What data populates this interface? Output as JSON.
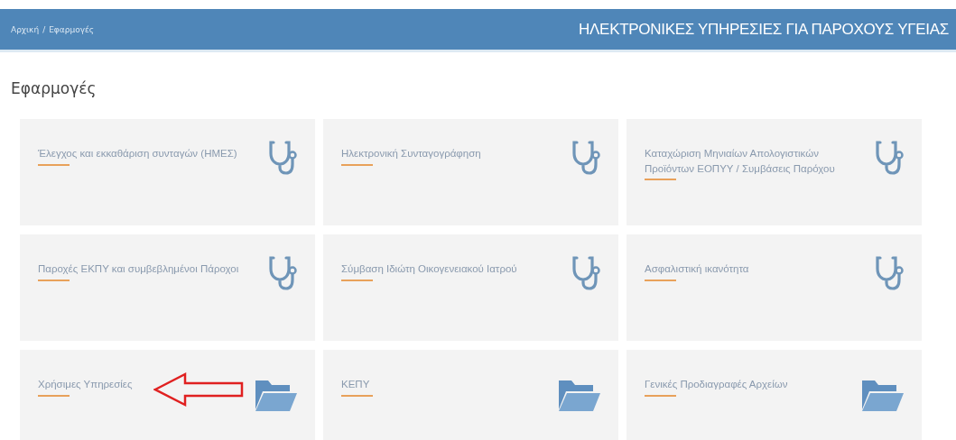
{
  "header": {
    "breadcrumb": [
      "Αρχική",
      "Εφαρμογές"
    ],
    "separator": "/",
    "title": "ΗΛΕΚΤΡΟΝΙΚΕΣ ΥΠΗΡΕΣΙΕΣ ΓΙΑ ΠΑΡΟΧΟΥΣ ΥΓΕΙΑΣ"
  },
  "page_title": "Εφαρμογές",
  "apps": [
    {
      "label": "Έλεγχος και εκκαθάριση συνταγών (ΗΜΕΣ)",
      "kind": "stethoscope",
      "arrow": false
    },
    {
      "label": "Ηλεκτρονική Συνταγογράφηση",
      "kind": "stethoscope",
      "arrow": false
    },
    {
      "label": "Καταχώριση Μηνιαίων Απολογιστικών Προϊόντων ΕΟΠΥΥ / Συμβάσεις Παρόχου",
      "kind": "stethoscope",
      "arrow": false
    },
    {
      "label": "Παροχές ΕΚΠΥ και συμβεβλημένοι Πάροχοι",
      "kind": "stethoscope",
      "arrow": false
    },
    {
      "label": "Σύμβαση Ιδιώτη Οικογενειακού Ιατρού",
      "kind": "stethoscope",
      "arrow": false
    },
    {
      "label": "Ασφαλιστική ικανότητα",
      "kind": "stethoscope",
      "arrow": false
    },
    {
      "label": "Χρήσιμες Υπηρεσίες",
      "kind": "folder",
      "arrow": true
    },
    {
      "label": "ΚΕΠΥ",
      "kind": "folder",
      "arrow": false
    },
    {
      "label": "Γενικές Προδιαγραφές Αρχείων",
      "kind": "folder",
      "arrow": false
    }
  ]
}
